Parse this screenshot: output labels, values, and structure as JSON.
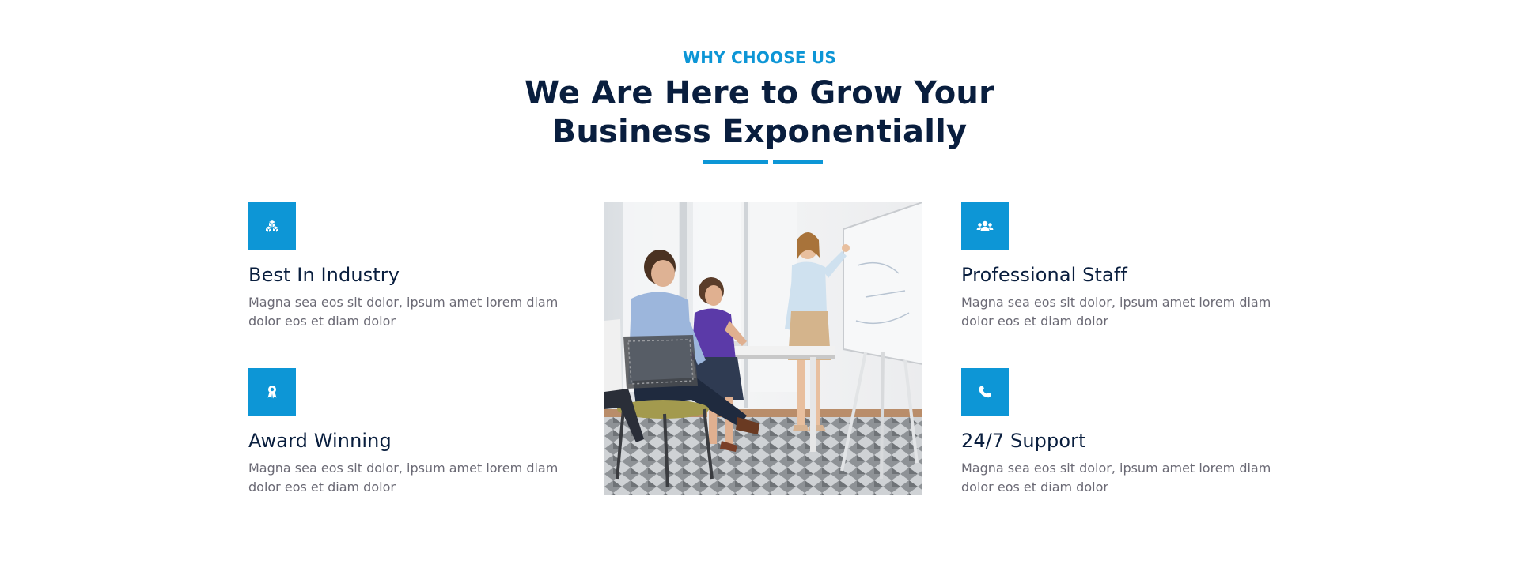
{
  "section": {
    "eyebrow": "WHY CHOOSE US",
    "headline": "We Are Here to Grow Your Business Exponentially"
  },
  "features": {
    "best_industry": {
      "title": "Best In Industry",
      "desc": "Magna sea eos sit dolor, ipsum amet lorem diam dolor eos et diam dolor",
      "icon": "cubes-icon"
    },
    "award_winning": {
      "title": "Award Winning",
      "desc": "Magna sea eos sit dolor, ipsum amet lorem diam dolor eos et diam dolor",
      "icon": "award-icon"
    },
    "professional_staff": {
      "title": "Professional Staff",
      "desc": "Magna sea eos sit dolor, ipsum amet lorem diam dolor eos et diam dolor",
      "icon": "users-icon"
    },
    "support": {
      "title": "24/7 Support",
      "desc": "Magna sea eos sit dolor, ipsum amet lorem diam dolor eos et diam dolor",
      "icon": "phone-icon"
    }
  },
  "colors": {
    "accent": "#0d96d6",
    "heading": "#091e3e",
    "body_text": "#6b6a75"
  }
}
